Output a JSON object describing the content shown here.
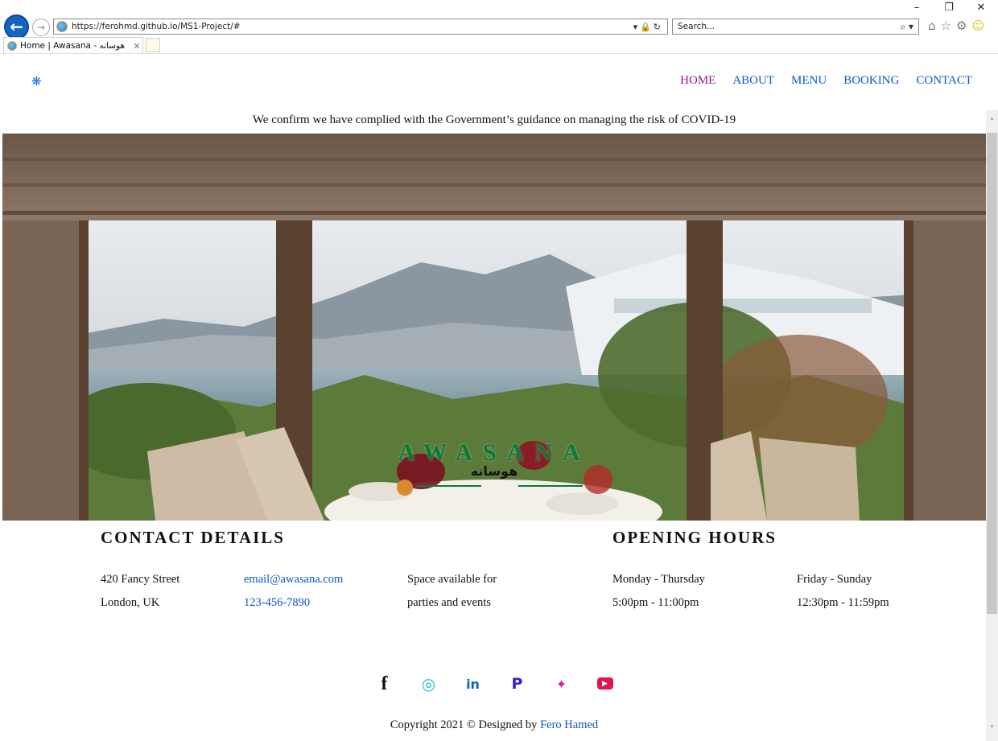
{
  "browser": {
    "address_url": "https://ferohmd.github.io/MS1-Project/#",
    "search_placeholder": "Search...",
    "tab_title": "Home | Awasana - هوسانه",
    "window_controls": [
      "–",
      "❐",
      "✕"
    ]
  },
  "site": {
    "brand_icon": "❋",
    "nav": [
      "HOME",
      "ABOUT",
      "MENU",
      "BOOKING",
      "CONTACT"
    ],
    "active_nav": "HOME",
    "covid_notice": "We confirm we have complied with the Government’s guidance on managing the risk of COVID-19",
    "hero": {
      "title": "AWASANA",
      "subtitle": "هوسانه"
    },
    "contact": {
      "heading": "CONTACT DETAILS",
      "address_line1": "420 Fancy Street",
      "address_line2": "London, UK",
      "email": "email@awasana.com",
      "phone": "123-456-7890",
      "space_line1": "Space available for",
      "space_line2": "parties and events"
    },
    "hours": {
      "heading": "OPENING HOURS",
      "weekday_label": "Monday - Thursday",
      "weekday_time": "5:00pm - 11:00pm",
      "weekend_label": "Friday - Sunday",
      "weekend_time": "12:30pm - 11:59pm"
    },
    "social": [
      {
        "name": "facebook-icon",
        "glyph": "f",
        "color": "#111111"
      },
      {
        "name": "instagram-icon",
        "glyph": "◎",
        "color": "#17c3c9"
      },
      {
        "name": "linkedin-icon",
        "glyph": "in",
        "color": "#0a66c2"
      },
      {
        "name": "pinterest-icon",
        "glyph": "P",
        "color": "#3c1bd6"
      },
      {
        "name": "twitter-icon",
        "glyph": "✦",
        "color": "#e0169b"
      },
      {
        "name": "youtube-icon",
        "glyph": "▶",
        "color": "#e0164f"
      }
    ],
    "copyright_text": "Copyright 2021 © Designed by ",
    "designer": "Fero Hamed"
  }
}
